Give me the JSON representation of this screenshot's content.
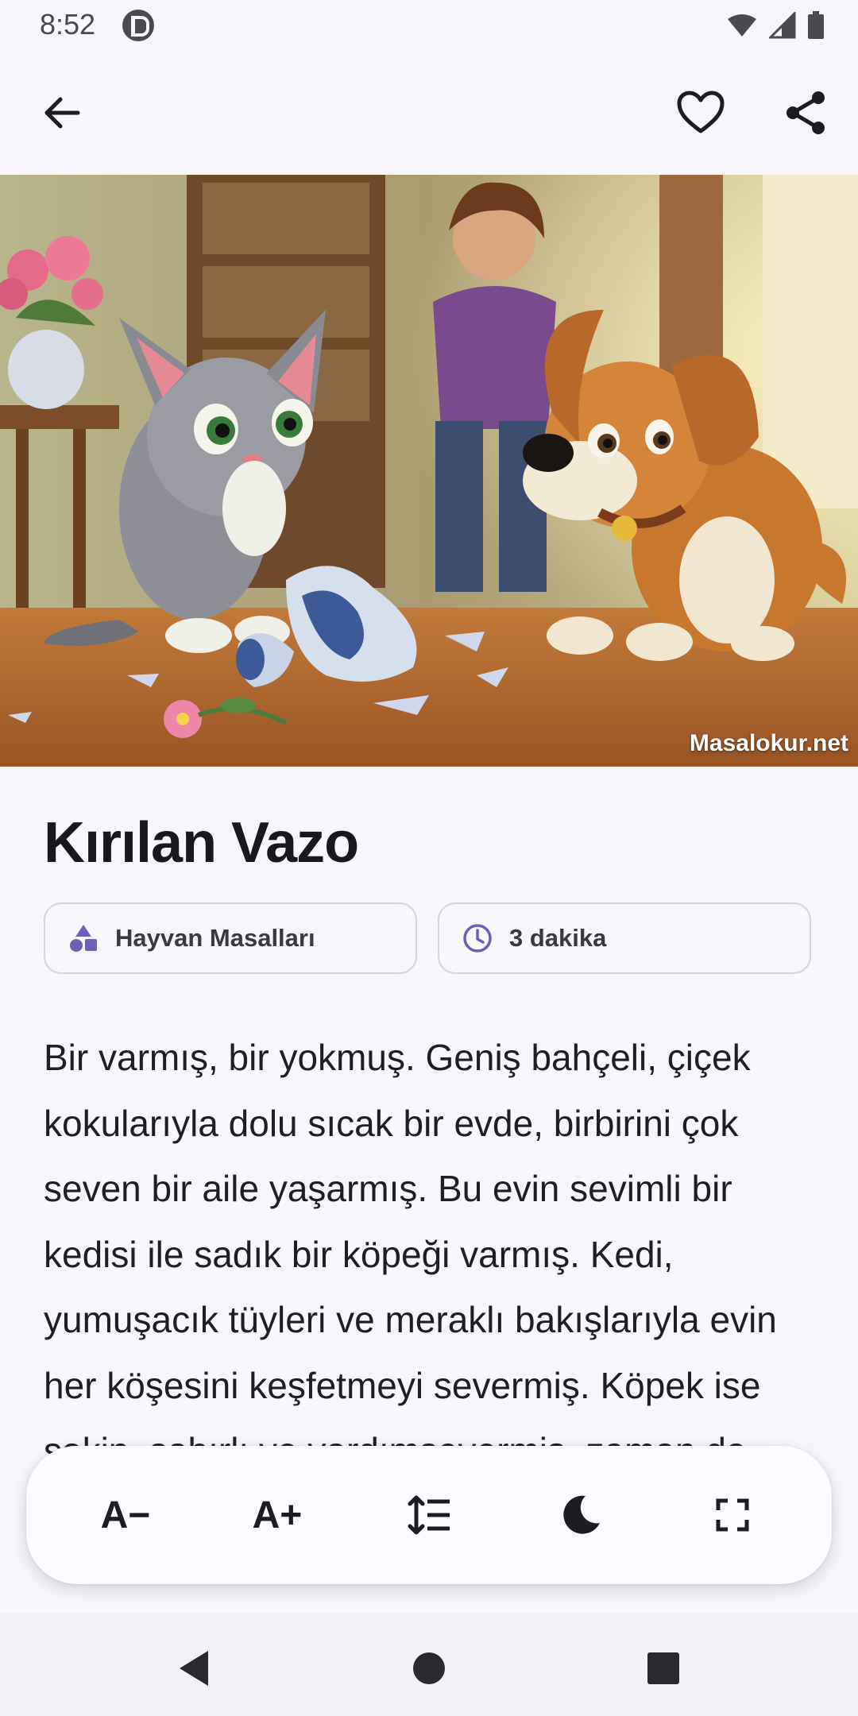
{
  "status_bar": {
    "time": "8:52"
  },
  "app_bar": {
    "back_icon": "arrow-left-icon",
    "favorite_icon": "heart-outline-icon",
    "share_icon": "share-icon"
  },
  "hero_image": {
    "watermark": "Masalokur.net"
  },
  "story": {
    "title": "Kırılan Vazo",
    "category": {
      "icon": "shapes-icon",
      "label": "Hayvan Masalları"
    },
    "read_time": {
      "icon": "clock-icon",
      "label": "3 dakika"
    },
    "body": "Bir varmış, bir yokmuş. Geniş bahçeli, çiçek kokularıyla dolu sıcak bir evde, birbirini çok seven bir aile yaşarmış. Bu evin sevimli bir kedisi ile sadık bir köpeği varmış. Kedi, yumuşacık tüyleri ve meraklı bakışlarıyla evin her köşesini keşfetmeyi severmiş. Köpek ise sakin, sabırlı ve yardımseverm̧iş. zaman da bahçede birlikte güneşlenirmiş."
  },
  "reader_toolbar": {
    "decrease_font_label": "A−",
    "increase_font_label": "A+",
    "line_spacing_icon": "line-spacing-icon",
    "dark_mode_icon": "moon-icon",
    "fullscreen_icon": "fullscreen-icon"
  },
  "nav_bar": {
    "back_icon": "nav-back-triangle-icon",
    "home_icon": "nav-home-circle-icon",
    "recents_icon": "nav-recents-square-icon"
  },
  "colors": {
    "accent": "#6e5fb8",
    "background": "#f8f6fb",
    "text": "#1a1a1f"
  }
}
